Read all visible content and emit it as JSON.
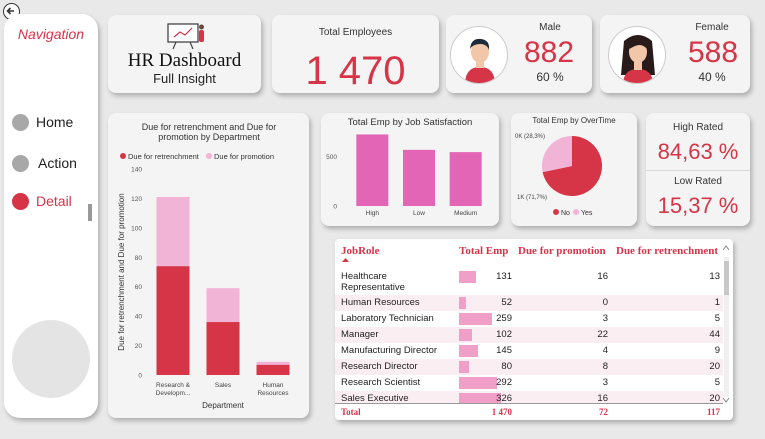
{
  "nav": {
    "title": "Navigation",
    "items": [
      {
        "label": "Home",
        "active": false
      },
      {
        "label": "Action",
        "active": false
      },
      {
        "label": "Detail",
        "active": true
      }
    ]
  },
  "header": {
    "title": "HR Dashboard",
    "subtitle": "Full Insight"
  },
  "kpis": {
    "total_label": "Total Employees",
    "total_value": "1 470",
    "male_label": "Male",
    "male_value": "882",
    "male_pct": "60 %",
    "female_label": "Female",
    "female_value": "588",
    "female_pct": "40 %",
    "high_rated_label": "High Rated",
    "high_rated_value": "84,63 %",
    "low_rated_label": "Low Rated",
    "low_rated_value": "15,37 %"
  },
  "colors": {
    "accent": "#d63447",
    "pink": "#eeb2d2",
    "magenta": "#e266b5"
  },
  "icons": {
    "back": "back-arrow-icon",
    "title": "presentation-board-icon",
    "male": "male-avatar-icon",
    "female": "female-avatar-icon"
  },
  "chart_data": [
    {
      "type": "bar",
      "stacked": true,
      "title": "Due for retrenchment and Due for promotion by Department",
      "categories": [
        "Research & Developm...",
        "Sales",
        "Human Resources"
      ],
      "series": [
        {
          "name": "Due for retrenchment",
          "values": [
            74,
            36,
            7
          ],
          "color": "#d63447"
        },
        {
          "name": "Due for promotion",
          "values": [
            47,
            23,
            2
          ],
          "color": "#f1b3d6"
        }
      ],
      "xlabel": "Department",
      "ylabel": "Due for retrenchment and Due for promotion",
      "ylim": [
        0,
        140
      ],
      "yticks": [
        0,
        20,
        40,
        60,
        80,
        100,
        120,
        140
      ],
      "legend": "top"
    },
    {
      "type": "bar",
      "title": "Total Emp by Job Satisfaction",
      "categories": [
        "High",
        "Low",
        "Medium"
      ],
      "values": [
        725,
        569,
        546
      ],
      "ylim": [
        0,
        760
      ],
      "yticks": [
        0,
        500
      ],
      "color": "#e266b5"
    },
    {
      "type": "pie",
      "title": "Total Emp by OverTime",
      "labels": [
        "No",
        "Yes"
      ],
      "values": [
        1054,
        416
      ],
      "slice_labels": [
        "1K (71,7%)",
        "0K (28,3%)"
      ],
      "colors": [
        "#d63447",
        "#f1b3d6"
      ],
      "legend": "bottom"
    }
  ],
  "table": {
    "headers": [
      "JobRole",
      "Total Emp",
      "Due for promotion",
      "Due for retrenchment"
    ],
    "rows": [
      {
        "role": "Healthcare Representative",
        "role_l1": "Healthcare",
        "role_l2": "Representative",
        "total": 131,
        "promo": 16,
        "retrench": 13
      },
      {
        "role": "Human Resources",
        "total": 52,
        "promo": 0,
        "retrench": 1
      },
      {
        "role": "Laboratory Technician",
        "total": 259,
        "promo": 3,
        "retrench": 5
      },
      {
        "role": "Manager",
        "total": 102,
        "promo": 22,
        "retrench": 44
      },
      {
        "role": "Manufacturing Director",
        "total": 145,
        "promo": 4,
        "retrench": 9
      },
      {
        "role": "Research Director",
        "total": 80,
        "promo": 8,
        "retrench": 20
      },
      {
        "role": "Research Scientist",
        "total": 292,
        "promo": 3,
        "retrench": 5
      },
      {
        "role": "Sales Executive",
        "total": 326,
        "promo": 16,
        "retrench": 20
      }
    ],
    "total_row": {
      "label": "Total",
      "total": "1 470",
      "promo": "72",
      "retrench": "117"
    }
  }
}
